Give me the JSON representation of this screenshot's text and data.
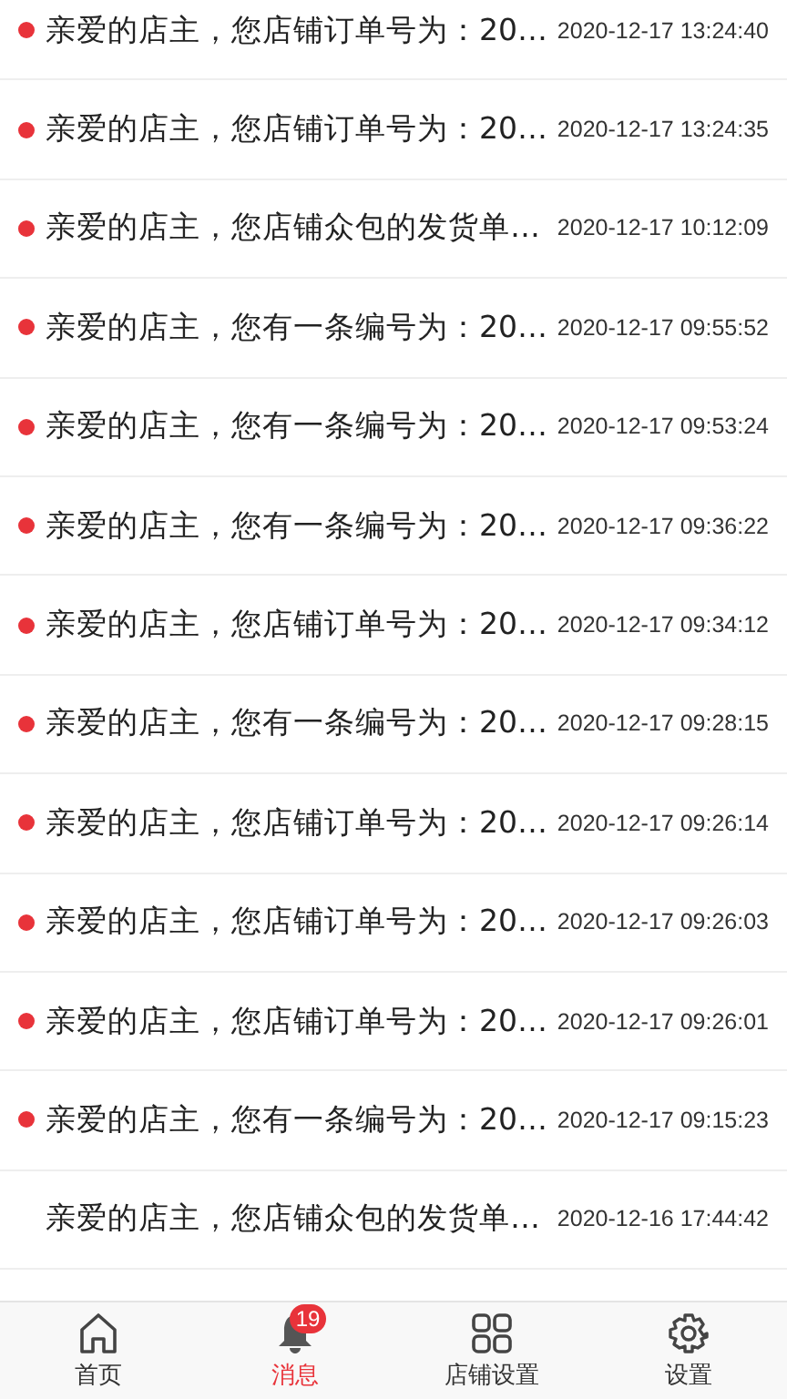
{
  "messages": [
    {
      "text": "亲爱的店主，您店铺订单号为：20…",
      "time": "2020-12-17 13:24:40",
      "unread": true
    },
    {
      "text": "亲爱的店主，您店铺订单号为：20…",
      "time": "2020-12-17 13:24:35",
      "unread": true
    },
    {
      "text": "亲爱的店主，您店铺众包的发货单…",
      "time": "2020-12-17 10:12:09",
      "unread": true
    },
    {
      "text": "亲爱的店主，您有一条编号为：20…",
      "time": "2020-12-17 09:55:52",
      "unread": true
    },
    {
      "text": "亲爱的店主，您有一条编号为：20…",
      "time": "2020-12-17 09:53:24",
      "unread": true
    },
    {
      "text": "亲爱的店主，您有一条编号为：20…",
      "time": "2020-12-17 09:36:22",
      "unread": true
    },
    {
      "text": "亲爱的店主，您店铺订单号为：20…",
      "time": "2020-12-17 09:34:12",
      "unread": true
    },
    {
      "text": "亲爱的店主，您有一条编号为：20…",
      "time": "2020-12-17 09:28:15",
      "unread": true
    },
    {
      "text": "亲爱的店主，您店铺订单号为：20…",
      "time": "2020-12-17 09:26:14",
      "unread": true
    },
    {
      "text": "亲爱的店主，您店铺订单号为：20…",
      "time": "2020-12-17 09:26:03",
      "unread": true
    },
    {
      "text": "亲爱的店主，您店铺订单号为：20…",
      "time": "2020-12-17 09:26:01",
      "unread": true
    },
    {
      "text": "亲爱的店主，您有一条编号为：20…",
      "time": "2020-12-17 09:15:23",
      "unread": true
    },
    {
      "text": "亲爱的店主，您店铺众包的发货单…",
      "time": "2020-12-16 17:44:42",
      "unread": false
    }
  ],
  "tabs": [
    {
      "kind": "home",
      "label": "首页",
      "selected": false
    },
    {
      "kind": "bell",
      "label": "消息",
      "selected": true,
      "badge": "19"
    },
    {
      "kind": "grid",
      "label": "店铺设置",
      "selected": false
    },
    {
      "kind": "gear",
      "label": "设置",
      "selected": false
    }
  ]
}
